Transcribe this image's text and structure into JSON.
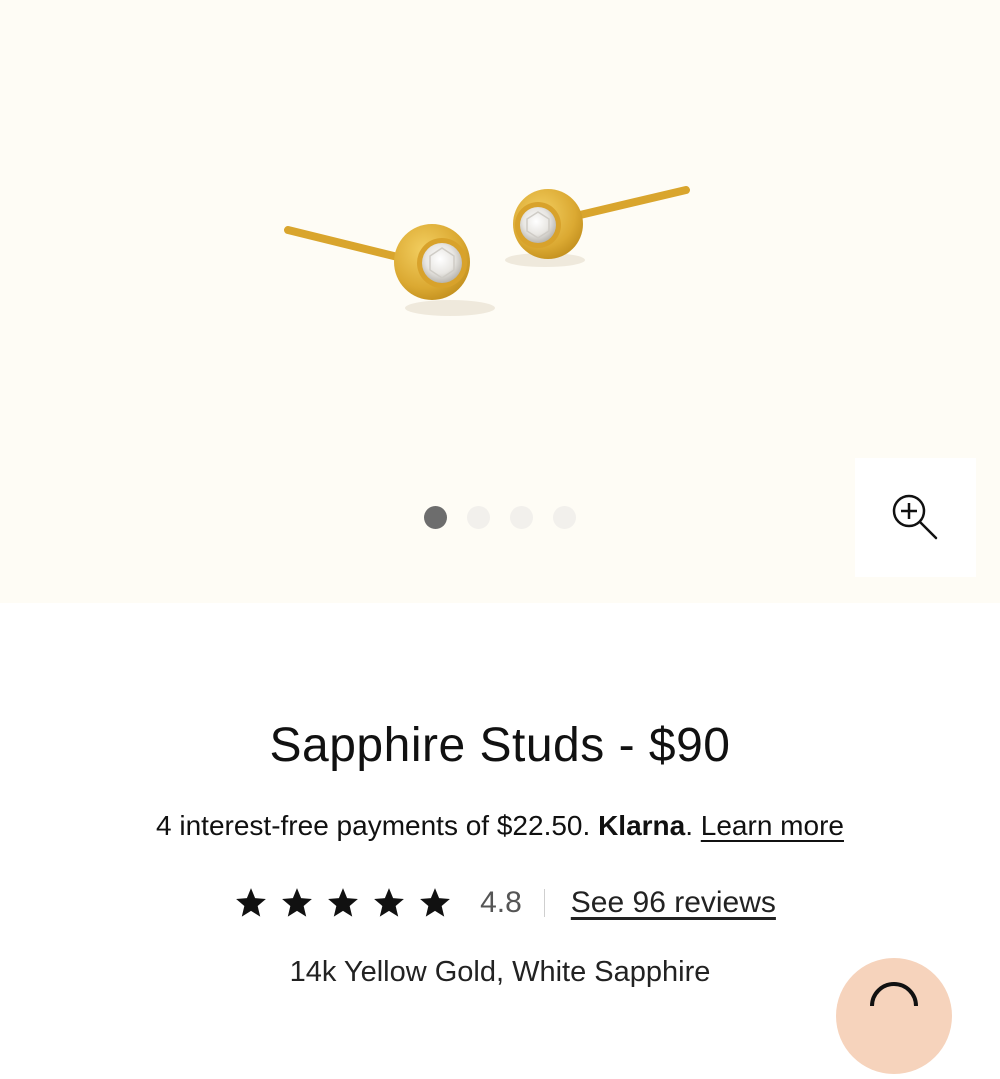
{
  "gallery": {
    "image_alt": "Sapphire Studs",
    "dots": [
      {
        "label": "Image 1",
        "active": true
      },
      {
        "label": "Image 2",
        "active": false
      },
      {
        "label": "Image 3",
        "active": false
      },
      {
        "label": "Image 4",
        "active": false
      }
    ],
    "zoom_icon": "zoom-in-icon"
  },
  "product": {
    "title": "Sapphire Studs - $90",
    "installments_text": "4 interest-free payments of $22.50.",
    "klarna_brand": "Klarna",
    "klarna_period": ".",
    "learn_more": "Learn more",
    "rating": {
      "stars": 5,
      "value": "4.8",
      "reviews_link": "See 96 reviews"
    },
    "variant": "14k Yellow Gold, White Sapphire"
  },
  "chat": {
    "icon": "chat-icon"
  },
  "colors": {
    "hero_bg": "#fefcf5",
    "gold": "#e2b33a",
    "active_dot": "#6d6d6d",
    "chat_bg": "#f6d3bc"
  }
}
